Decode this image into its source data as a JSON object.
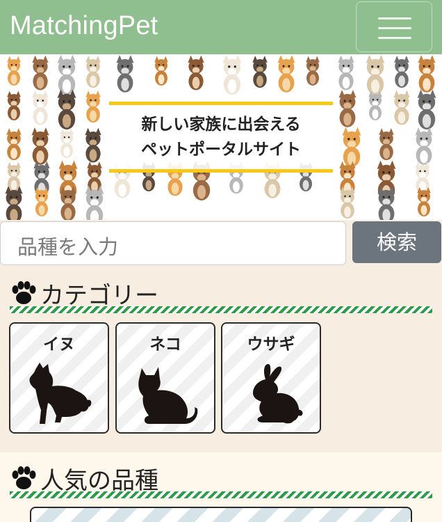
{
  "header": {
    "brand": "MatchingPet",
    "menu_icon": "hamburger-menu-icon"
  },
  "hero": {
    "line1": "新しい家族に出会える",
    "line2": "ペットポータルサイト"
  },
  "search": {
    "placeholder": "品種を入力",
    "button_label": "検索"
  },
  "categories": {
    "title": "カテゴリー",
    "items": [
      {
        "label": "イヌ",
        "icon": "dog-silhouette-icon"
      },
      {
        "label": "ネコ",
        "icon": "cat-silhouette-icon"
      },
      {
        "label": "ウサギ",
        "icon": "rabbit-silhouette-icon"
      }
    ]
  },
  "popular": {
    "title": "人気の品種"
  },
  "colors": {
    "header": "#8fbf8f",
    "accent_yellow": "#f7c815",
    "stripe_green": "#2f9a4a",
    "search_button": "#6c757d",
    "background": "#f7ede1"
  }
}
